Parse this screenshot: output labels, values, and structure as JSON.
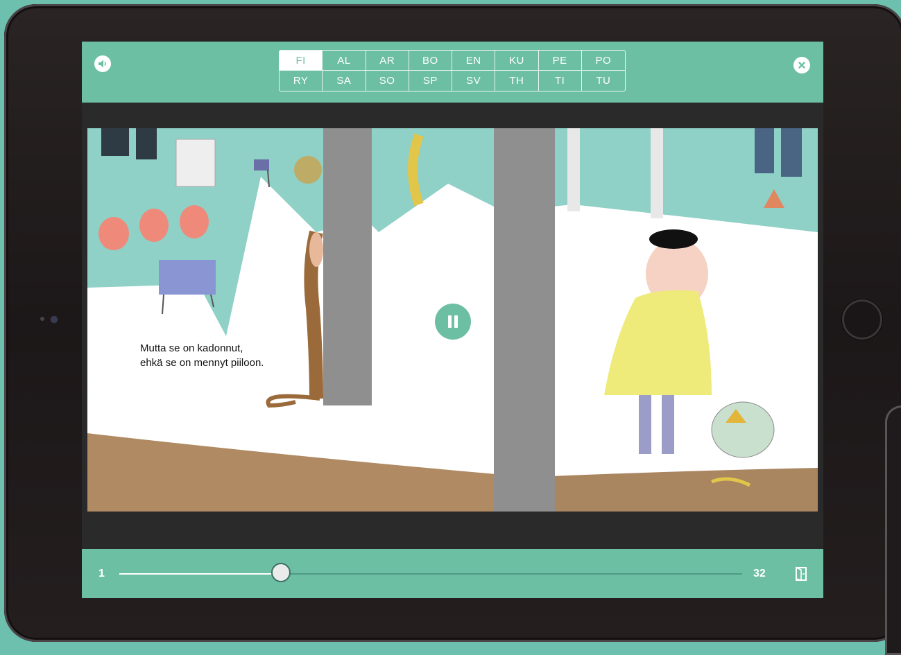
{
  "languages": {
    "row1": [
      "FI",
      "AL",
      "AR",
      "BO",
      "EN",
      "KU",
      "PE",
      "PO"
    ],
    "row2": [
      "RY",
      "SA",
      "SO",
      "SP",
      "SV",
      "TH",
      "TI",
      "TU"
    ],
    "selected": "FI"
  },
  "icons": {
    "sound": "speaker-icon",
    "close": "close-icon",
    "pause": "pause-icon",
    "exit": "exit-book-icon"
  },
  "story": {
    "text": "Mutta se on kadonnut,\nehkä se on mennyt piiloon."
  },
  "slider": {
    "start_label": "1",
    "end_label": "32",
    "progress": 0.26
  },
  "colors": {
    "accent": "#6dbfa4",
    "background": "#6dbfae",
    "bezel": "#1c1718"
  }
}
